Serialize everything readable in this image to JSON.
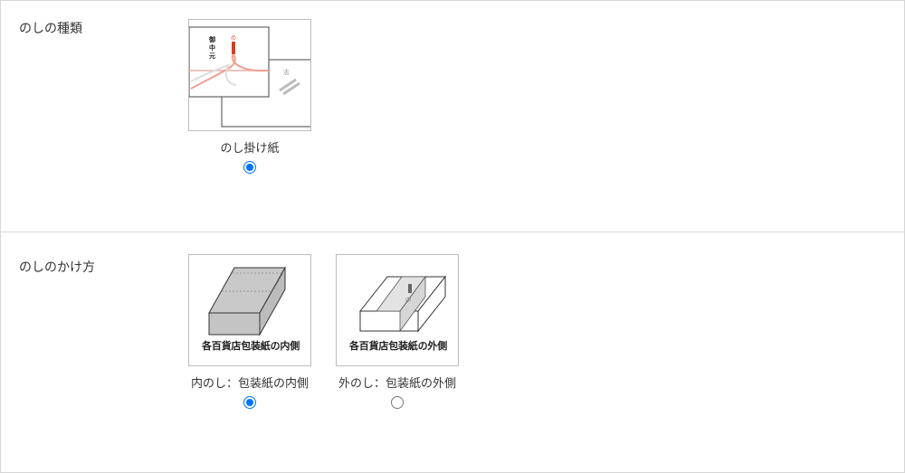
{
  "section_noshi_type": {
    "label": "のしの種類",
    "options": [
      {
        "label": "のし掛け紙",
        "checked": true,
        "image_icon": "noshi-kakegami-image"
      }
    ]
  },
  "section_noshi_method": {
    "label": "のしのかけ方",
    "options": [
      {
        "label": "内のし：包装紙の内側",
        "caption": "各百貨店包装紙の内側",
        "checked": true,
        "image_icon": "inner-wrap-box-image"
      },
      {
        "label": "外のし：包装紙の外側",
        "caption": "各百貨店包装紙の外側",
        "checked": false,
        "image_icon": "outer-wrap-box-image"
      }
    ]
  },
  "colors": {
    "accent": "#0075ff",
    "border": "#d6d6d6",
    "mizuhiki": "#f0a090"
  }
}
